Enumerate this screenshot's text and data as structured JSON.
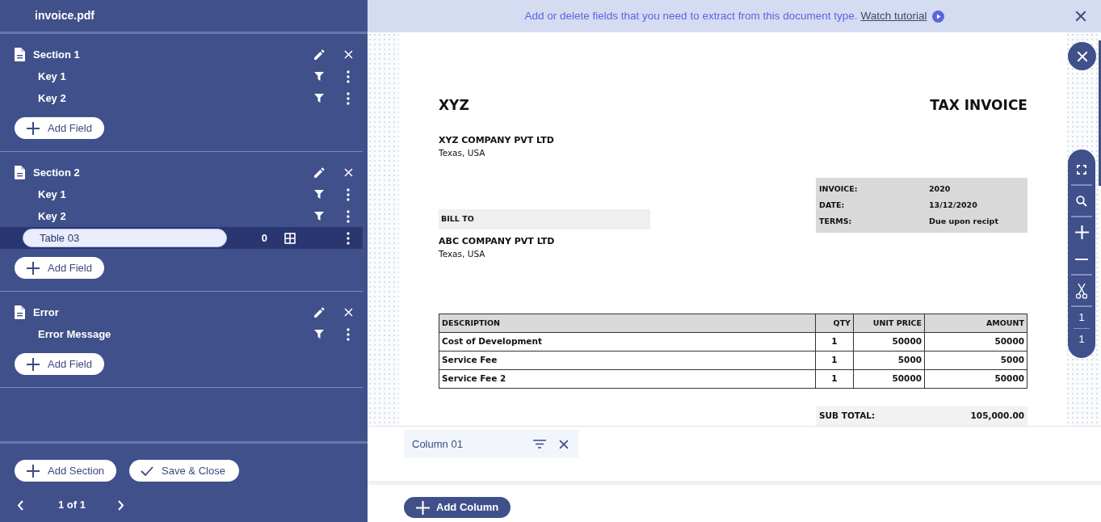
{
  "file_name": "invoice.pdf",
  "sections": [
    {
      "title": "Section 1",
      "fields": [
        {
          "kind": "key",
          "label": "Key 1",
          "selected": false
        },
        {
          "kind": "key",
          "label": "Key 2",
          "selected": false
        }
      ],
      "add_field": "Add Field"
    },
    {
      "title": "Section 2",
      "fields": [
        {
          "kind": "key",
          "label": "Key 1",
          "selected": false
        },
        {
          "kind": "key",
          "label": "Key 2",
          "selected": false
        },
        {
          "kind": "table",
          "value": "Table 03",
          "count": "0",
          "selected": true
        }
      ],
      "add_field": "Add Field"
    },
    {
      "title": "Error",
      "fields": [
        {
          "kind": "key",
          "label": "Error Message",
          "selected": false
        }
      ],
      "add_field": "Add Field"
    }
  ],
  "footer": {
    "add_section": "Add Section",
    "save_close": "Save & Close",
    "pager": "1 of 1"
  },
  "banner": {
    "text": "Add or delete fields that you need to extract from this document type.",
    "link": "Watch tutorial"
  },
  "document": {
    "title_left": "XYZ",
    "title_right": "TAX INVOICE",
    "seller": {
      "name": "XYZ COMPANY PVT LTD",
      "address": "Texas, USA"
    },
    "info": [
      {
        "label": "INVOICE:",
        "value": "2020"
      },
      {
        "label": "DATE:",
        "value": "13/12/2020"
      },
      {
        "label": "TERMS:",
        "value": "Due upon recipt"
      }
    ],
    "bill_to": {
      "label": "BILL TO",
      "name": "ABC COMPANY PVT LTD",
      "address": "Texas, USA"
    },
    "table": {
      "columns": [
        "DESCRIPTION",
        "QTY",
        "UNIT PRICE",
        "AMOUNT"
      ],
      "rows": [
        [
          "Cost of Development",
          "1",
          "50000",
          "50000"
        ],
        [
          "Service Fee",
          "1",
          "5000",
          "5000"
        ],
        [
          "Service Fee 2",
          "1",
          "50000",
          "50000"
        ]
      ]
    },
    "totals": [
      {
        "label": "SUB TOTAL:",
        "value": "105,000.00"
      }
    ]
  },
  "viewer_tools": {
    "page_current": "1",
    "page_total": "1"
  },
  "columns_panel": {
    "columns": [
      {
        "label": "Column 01"
      }
    ],
    "add_column": "Add Column"
  }
}
